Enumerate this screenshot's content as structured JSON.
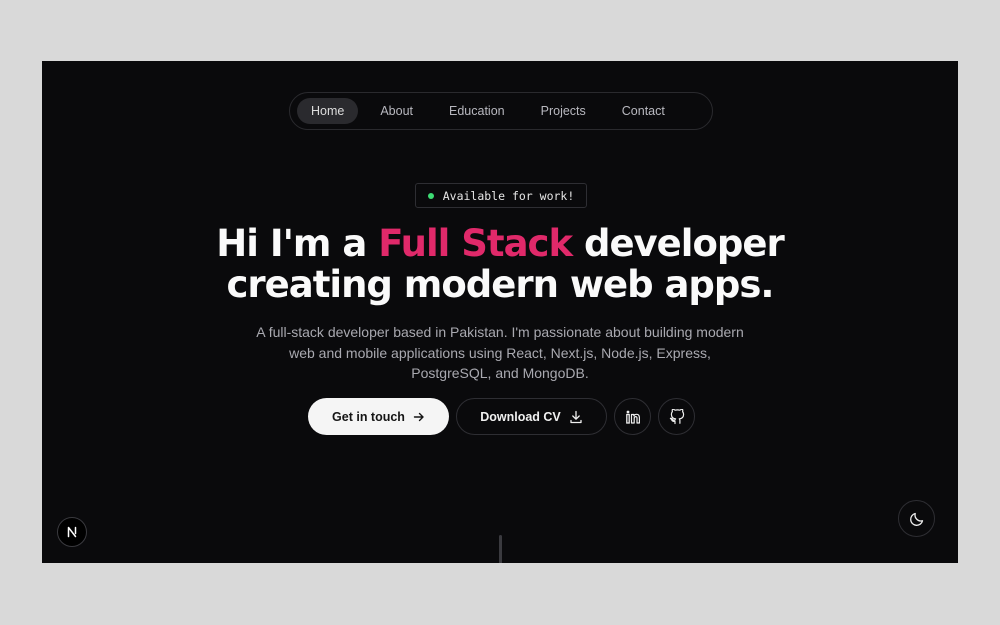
{
  "nav": {
    "items": [
      {
        "label": "Home",
        "active": true
      },
      {
        "label": "About"
      },
      {
        "label": "Education"
      },
      {
        "label": "Projects"
      },
      {
        "label": "Contact"
      }
    ]
  },
  "badge": {
    "text": "Available for work!",
    "dot_color": "#3ddc74"
  },
  "hero": {
    "title_before": "Hi I'm a ",
    "title_accent": "Full Stack",
    "title_after": " developer",
    "title_line2": "creating modern web apps.",
    "accent_color": "#e0296a",
    "subtitle": "A full-stack developer based in Pakistan. I'm passionate about building modern web and mobile applications using React, Next.js, Node.js, Express, PostgreSQL, and MongoDB."
  },
  "actions": {
    "primary_label": "Get in touch",
    "primary_icon": "arrow-right-icon",
    "secondary_label": "Download CV",
    "secondary_icon": "download-icon",
    "social": [
      "linkedin-icon",
      "github-icon"
    ]
  },
  "corner": {
    "logo_icon": "n-logo-icon",
    "theme_icon": "moon-icon"
  }
}
